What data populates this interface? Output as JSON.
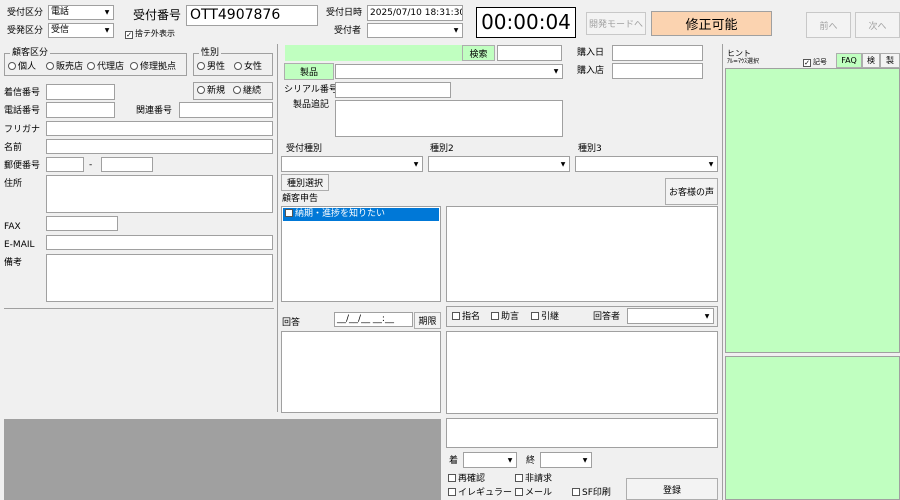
{
  "top": {
    "uketsuke_kubun_label": "受付区分",
    "uketsuke_kubun_value": "電話",
    "juhatsu_kubun_label": "受発区分",
    "juhatsu_kubun_value": "受信",
    "uketsuke_bangou_label": "受付番号",
    "uketsuke_bangou_value": "OTT4907876",
    "sute_hyouji_label": "捨テ外表示",
    "uketsuke_nichiji_label": "受付日時",
    "uketsuke_nichiji_value": "2025/07/10 18:31:30",
    "uketsukesha_label": "受付者",
    "timer": "00:00:04",
    "kaihatsu_mode_label": "開発モードへ",
    "shusei_kanou_label": "修正可能",
    "mae_label": "前へ",
    "tsugi_label": "次へ"
  },
  "customer": {
    "kokyaku_kubun_caption": "顧客区分",
    "kubun_options": [
      "個人",
      "販売店",
      "代理店",
      "修理拠点"
    ],
    "seibetsu_caption": "性別",
    "seibetsu_options": [
      "男性",
      "女性"
    ],
    "keizoku_options": [
      "新規",
      "継続"
    ],
    "chakushin_label": "着信番号",
    "denwa_label": "電話番号",
    "kanren_label": "関連番号",
    "furigana_label": "フリガナ",
    "namae_label": "名前",
    "yubin_label": "郵便番号",
    "yubin_dash": "-",
    "jusho_label": "住所",
    "fax_label": "FAX",
    "email_label": "E-MAIL",
    "biko_label": "備考"
  },
  "product": {
    "kensaku_label": "検索",
    "seihin_label": "製品",
    "kounyubi_label": "購入日",
    "kounyuten_label": "購入店",
    "serial_label": "シリアル番号",
    "seihin_ki_label": "製品追記"
  },
  "category": {
    "uketsuke_shubetsu_label": "受付種別",
    "shubetsu2_label": "種別2",
    "shubetsu3_label": "種別3",
    "shubetsu_sentaku_label": "種別選択",
    "okyakusama_label": "お客様の声",
    "kokyaku_shinkoku_label": "顧客申告",
    "shinkoku_items": [
      "納期・進捗を知りたい"
    ]
  },
  "answer": {
    "kaitou_label": "回答",
    "date_placeholder": "__/__/__ __:__",
    "kigen_label": "期限",
    "shimei_label": "指名",
    "jogen_label": "助言",
    "hikitsugi_label": "引継",
    "kaitousha_label": "回答者"
  },
  "bottom": {
    "chaku_label": "着",
    "shuu_label": "終",
    "saikakunin_label": "再確認",
    "hiseikyu_label": "非請求",
    "iregyura_label": "イレギュラー",
    "meru_label": "メール",
    "sf_insatsu_label": "SF印刷",
    "touroku_label": "登録"
  },
  "hint": {
    "caption": "ヒント",
    "sub_label": "ｱﾙ=ﾏｳｽ選択",
    "kigou_label": "記号",
    "tabs": [
      "FAQ",
      "検",
      "製"
    ]
  },
  "colors": {
    "green": "#c0ffc0",
    "orange": "#fbd3b0"
  }
}
